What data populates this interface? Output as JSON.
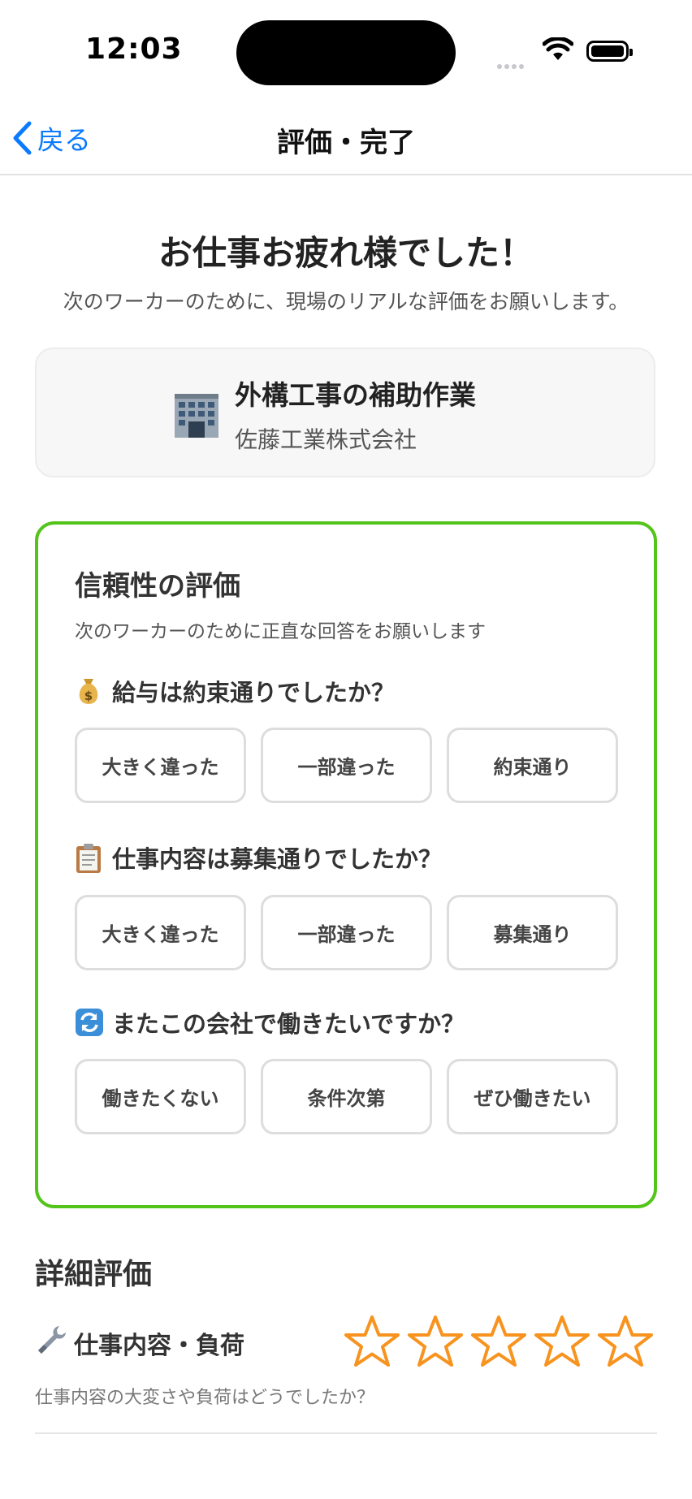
{
  "status_bar": {
    "time": "12:03"
  },
  "nav": {
    "back_label": "戻る",
    "title": "評価・完了"
  },
  "header": {
    "title": "お仕事お疲れ様でした！",
    "subtitle": "次のワーカーのために、現場のリアルな評価をお願いします。"
  },
  "job": {
    "icon": "building-icon",
    "title": "外構工事の補助作業",
    "company": "佐藤工業株式会社"
  },
  "reliability": {
    "title": "信頼性の評価",
    "subtitle": "次のワーカーのために正直な回答をお願いします",
    "border_color": "#52c41a",
    "questions": [
      {
        "icon": "money-bag-icon",
        "text": "給与は約束通りでしたか？",
        "options": [
          "大きく違った",
          "一部違った",
          "約束通り"
        ]
      },
      {
        "icon": "clipboard-icon",
        "text": "仕事内容は募集通りでしたか？",
        "options": [
          "大きく違った",
          "一部違った",
          "募集通り"
        ]
      },
      {
        "icon": "repeat-icon",
        "text": "またこの会社で働きたいですか？",
        "options": [
          "働きたくない",
          "条件次第",
          "ぜひ働きたい"
        ]
      }
    ]
  },
  "details": {
    "title": "詳細評価",
    "items": [
      {
        "icon": "wrench-icon",
        "label": "仕事内容・負荷",
        "description": "仕事内容の大変さや負荷はどうでしたか？",
        "rating": 0,
        "max_rating": 5,
        "star_color": "#f7931e"
      }
    ]
  }
}
